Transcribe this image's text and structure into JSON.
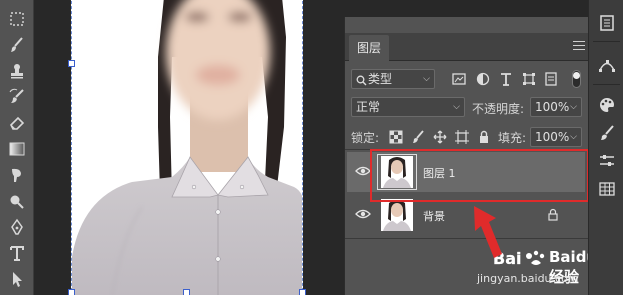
{
  "panel": {
    "tab_label": "图层",
    "filter_kind": "类型",
    "blend_mode": "正常",
    "opacity_label": "不透明度:",
    "opacity_value": "100%",
    "lock_label": "锁定:",
    "fill_label": "填充:",
    "fill_value": "100%",
    "collapse_glyph": "«"
  },
  "layers": [
    {
      "name": "图层 1",
      "visible": true,
      "selected": true
    },
    {
      "name": "背景",
      "visible": true,
      "locked": true
    }
  ],
  "watermark": {
    "brand": "Baidu经验",
    "url": "jingyan.baidu.com"
  },
  "colors": {
    "highlight": "#e02b2b",
    "selection": "#6d8ed6"
  }
}
